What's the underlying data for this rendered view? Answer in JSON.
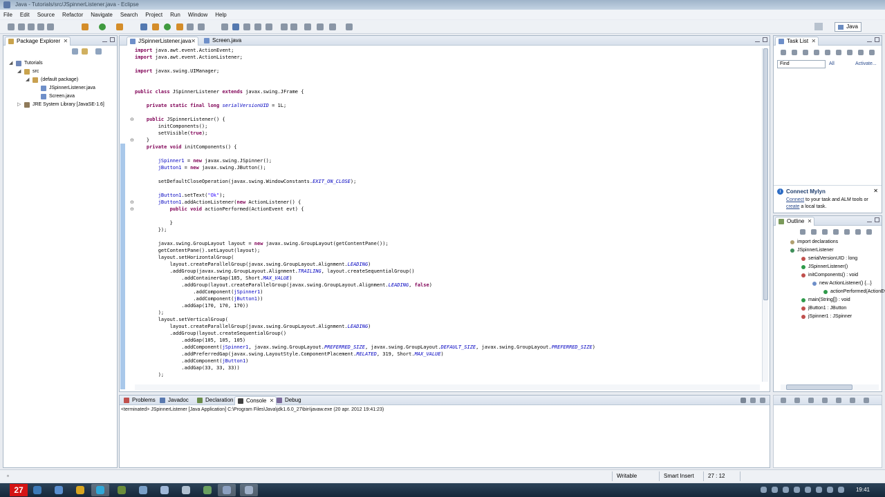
{
  "window": {
    "title": "Java - Tutorials/src/JSpinnerListener.java - Eclipse"
  },
  "menu": [
    "File",
    "Edit",
    "Source",
    "Refactor",
    "Navigate",
    "Search",
    "Project",
    "Run",
    "Window",
    "Help"
  ],
  "perspective": "Java",
  "package_explorer": {
    "tab": "Package Explorer",
    "tree": [
      {
        "label": "Tutorials",
        "depth": 0,
        "icon": "project-icon",
        "color": "#6e86b7"
      },
      {
        "label": "src",
        "depth": 1,
        "icon": "source-folder-icon",
        "color": "#c9a34d"
      },
      {
        "label": "(default package)",
        "depth": 2,
        "icon": "package-icon",
        "color": "#c8a050"
      },
      {
        "label": "JSpinnerListener.java",
        "depth": 3,
        "icon": "java-file-icon",
        "color": "#6e8fc9"
      },
      {
        "label": "Screen.java",
        "depth": 3,
        "icon": "java-file-icon",
        "color": "#6e8fc9"
      },
      {
        "label": "JRE System Library [JavaSE-1.6]",
        "depth": 1,
        "icon": "library-icon",
        "color": "#8f7a5a"
      }
    ]
  },
  "editor": {
    "tabs": [
      "JSpinnerListener.java",
      "Screen.java"
    ],
    "lines": [
      [
        [
          "kw",
          "import"
        ],
        [
          "t",
          " java.awt.event.ActionEvent;"
        ]
      ],
      [
        [
          "kw",
          "import"
        ],
        [
          "t",
          " java.awt.event.ActionListener;"
        ]
      ],
      [
        [
          "t",
          ""
        ]
      ],
      [
        [
          "kw",
          "import"
        ],
        [
          "t",
          " javax.swing.UIManager;"
        ]
      ],
      [
        [
          "t",
          ""
        ]
      ],
      [
        [
          "t",
          ""
        ]
      ],
      [
        [
          "kw",
          "public class"
        ],
        [
          "t",
          " JSpinnerListener "
        ],
        [
          "kw",
          "extends"
        ],
        [
          "t",
          " javax.swing.JFrame {"
        ]
      ],
      [
        [
          "t",
          ""
        ]
      ],
      [
        [
          "t",
          "    "
        ],
        [
          "kw",
          "private static final long"
        ],
        [
          "t",
          " "
        ],
        [
          "it",
          "serialVersionUID"
        ],
        [
          "t",
          " = 1L;"
        ]
      ],
      [
        [
          "t",
          ""
        ]
      ],
      [
        [
          "t",
          "    "
        ],
        [
          "kw",
          "public"
        ],
        [
          "t",
          " JSpinnerListener() {"
        ]
      ],
      [
        [
          "t",
          "        initComponents();"
        ]
      ],
      [
        [
          "t",
          "        setVisible("
        ],
        [
          "kw",
          "true"
        ],
        [
          "t",
          ");"
        ]
      ],
      [
        [
          "t",
          "    }"
        ]
      ],
      [
        [
          "t",
          "    "
        ],
        [
          "kw",
          "private void"
        ],
        [
          "t",
          " initComponents() {"
        ]
      ],
      [
        [
          "t",
          ""
        ]
      ],
      [
        [
          "t",
          "        "
        ],
        [
          "fld",
          "jSpinner1"
        ],
        [
          "t",
          " = "
        ],
        [
          "kw",
          "new"
        ],
        [
          "t",
          " javax.swing.JSpinner();"
        ]
      ],
      [
        [
          "t",
          "        "
        ],
        [
          "fld",
          "jButton1"
        ],
        [
          "t",
          " = "
        ],
        [
          "kw",
          "new"
        ],
        [
          "t",
          " javax.swing.JButton();"
        ]
      ],
      [
        [
          "t",
          ""
        ]
      ],
      [
        [
          "t",
          "        setDefaultCloseOperation(javax.swing.WindowConstants."
        ],
        [
          "it",
          "EXIT_ON_CLOSE"
        ],
        [
          "t",
          ");"
        ]
      ],
      [
        [
          "t",
          ""
        ]
      ],
      [
        [
          "t",
          "        "
        ],
        [
          "fld",
          "jButton1"
        ],
        [
          "t",
          ".setText("
        ],
        [
          "str",
          "\"Ok\""
        ],
        [
          "t",
          ");"
        ]
      ],
      [
        [
          "t",
          "        "
        ],
        [
          "fld",
          "jButton1"
        ],
        [
          "t",
          ".addActionListener("
        ],
        [
          "kw",
          "new"
        ],
        [
          "t",
          " ActionListener() {"
        ]
      ],
      [
        [
          "t",
          "            "
        ],
        [
          "kw",
          "public void"
        ],
        [
          "t",
          " actionPerformed(ActionEvent evt) {"
        ]
      ],
      [
        [
          "t",
          ""
        ]
      ],
      [
        [
          "t",
          "            }"
        ]
      ],
      [
        [
          "t",
          "        });"
        ]
      ],
      [
        [
          "t",
          ""
        ]
      ],
      [
        [
          "t",
          "        javax.swing.GroupLayout layout = "
        ],
        [
          "kw",
          "new"
        ],
        [
          "t",
          " javax.swing.GroupLayout(getContentPane());"
        ]
      ],
      [
        [
          "t",
          "        getContentPane().setLayout(layout);"
        ]
      ],
      [
        [
          "t",
          "        layout.setHorizontalGroup("
        ]
      ],
      [
        [
          "t",
          "            layout.createParallelGroup(javax.swing.GroupLayout.Alignment."
        ],
        [
          "it",
          "LEADING"
        ],
        [
          "t",
          ")"
        ]
      ],
      [
        [
          "t",
          "            .addGroup(javax.swing.GroupLayout.Alignment."
        ],
        [
          "it",
          "TRAILING"
        ],
        [
          "t",
          ", layout.createSequentialGroup()"
        ]
      ],
      [
        [
          "t",
          "                .addContainerGap(185, Short."
        ],
        [
          "it",
          "MAX_VALUE"
        ],
        [
          "t",
          ")"
        ]
      ],
      [
        [
          "t",
          "                .addGroup(layout.createParallelGroup(javax.swing.GroupLayout.Alignment."
        ],
        [
          "it",
          "LEADING"
        ],
        [
          "t",
          ", "
        ],
        [
          "kw",
          "false"
        ],
        [
          "t",
          ")"
        ]
      ],
      [
        [
          "t",
          "                    .addComponent("
        ],
        [
          "fld",
          "jSpinner1"
        ],
        [
          "t",
          ")"
        ]
      ],
      [
        [
          "t",
          "                    .addComponent("
        ],
        [
          "fld",
          "jButton1"
        ],
        [
          "t",
          "))"
        ]
      ],
      [
        [
          "t",
          "                .addGap(170, 170, 170))"
        ]
      ],
      [
        [
          "t",
          "        );"
        ]
      ],
      [
        [
          "t",
          "        layout.setVerticalGroup("
        ]
      ],
      [
        [
          "t",
          "            layout.createParallelGroup(javax.swing.GroupLayout.Alignment."
        ],
        [
          "it",
          "LEADING"
        ],
        [
          "t",
          ")"
        ]
      ],
      [
        [
          "t",
          "            .addGroup(layout.createSequentialGroup()"
        ]
      ],
      [
        [
          "t",
          "                .addGap(105, 105, 105)"
        ]
      ],
      [
        [
          "t",
          "                .addComponent("
        ],
        [
          "fld",
          "jSpinner1"
        ],
        [
          "t",
          ", javax.swing.GroupLayout."
        ],
        [
          "it",
          "PREFERRED_SIZE"
        ],
        [
          "t",
          ", javax.swing.GroupLayout."
        ],
        [
          "it",
          "DEFAULT_SIZE"
        ],
        [
          "t",
          ", javax.swing.GroupLayout."
        ],
        [
          "it",
          "PREFERRED_SIZE"
        ],
        [
          "t",
          ")"
        ]
      ],
      [
        [
          "t",
          "                .addPreferredGap(javax.swing.LayoutStyle.ComponentPlacement."
        ],
        [
          "it",
          "RELATED"
        ],
        [
          "t",
          ", 319, Short."
        ],
        [
          "it",
          "MAX_VALUE"
        ],
        [
          "t",
          ")"
        ]
      ],
      [
        [
          "t",
          "                .addComponent("
        ],
        [
          "fld",
          "jButton1"
        ],
        [
          "t",
          ")"
        ]
      ],
      [
        [
          "t",
          "                .addGap(33, 33, 33))"
        ]
      ],
      [
        [
          "t",
          "        );"
        ]
      ]
    ]
  },
  "console": {
    "tabs": [
      "Problems",
      "Javadoc",
      "Declaration",
      "Console",
      "Debug"
    ],
    "terminated": "<terminated> JSpinnerListener [Java Application] C:\\Program Files\\Java\\jdk1.6.0_27\\bin\\javaw.exe (20 apr. 2012 19:41:23)"
  },
  "task_list": {
    "tab": "Task List",
    "find_placeholder": "Find",
    "all": "All",
    "activate": "Activate..."
  },
  "mylyn": {
    "title": "Connect Mylyn",
    "connect": "Connect",
    "mid": " to your task and ALM tools or ",
    "create": "create",
    "end": " a local task."
  },
  "outline": {
    "tab": "Outline",
    "items": [
      {
        "label": "import declarations",
        "depth": 0,
        "color": "#b0a070"
      },
      {
        "label": "JSpinnerListener",
        "depth": 0,
        "color": "#3f8f5a"
      },
      {
        "label": "serialVersionUID : long",
        "depth": 1,
        "color": "#c0504d"
      },
      {
        "label": "JSpinnerListener()",
        "depth": 1,
        "color": "#2e9a4a"
      },
      {
        "label": "initComponents() : void",
        "depth": 1,
        "color": "#c0504d"
      },
      {
        "label": "new ActionListener() {...}",
        "depth": 2,
        "color": "#6e8fc9"
      },
      {
        "label": "actionPerformed(ActionEvent)",
        "depth": 3,
        "color": "#2e9a4a"
      },
      {
        "label": "main(String[]) : void",
        "depth": 1,
        "color": "#2e9a4a"
      },
      {
        "label": "jButton1 : JButton",
        "depth": 1,
        "color": "#c0504d"
      },
      {
        "label": "jSpinner1 : JSpinner",
        "depth": 1,
        "color": "#c0504d"
      }
    ]
  },
  "status": {
    "writable": "Writable",
    "insert": "Smart Insert",
    "position": "27 : 12"
  },
  "taskbar": {
    "clock": "19:41",
    "logo": "27"
  }
}
